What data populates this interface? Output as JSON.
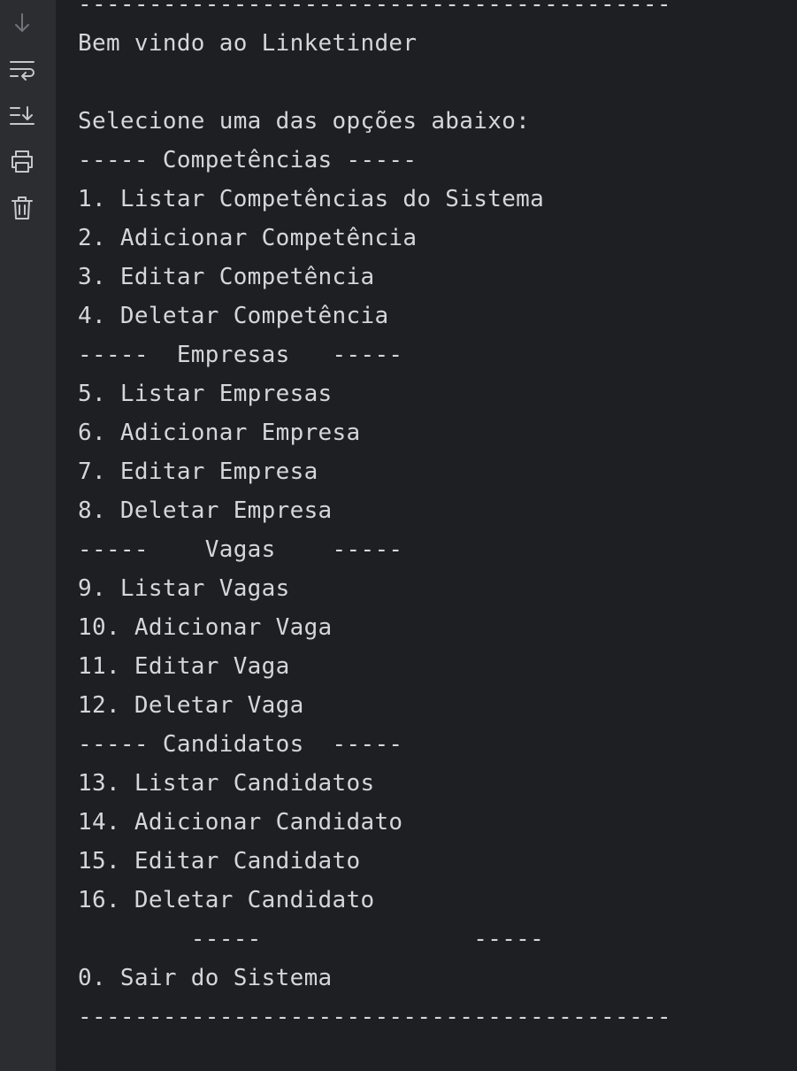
{
  "toolbar": {
    "icons": [
      "arrow-down-icon",
      "soft-wrap-icon",
      "scroll-to-end-icon",
      "print-icon",
      "trash-icon"
    ],
    "icon_color": "#8c9096"
  },
  "console": {
    "text_color": "#d4d6dc",
    "background": "#1e1f22",
    "lines": [
      "------------------------------------------",
      "Bem vindo ao Linketinder",
      "",
      "Selecione uma das opções abaixo:",
      "----- Competências -----",
      "1. Listar Competências do Sistema",
      "2. Adicionar Competência",
      "3. Editar Competência",
      "4. Deletar Competência",
      "-----  Empresas   -----",
      "5. Listar Empresas",
      "6. Adicionar Empresa",
      "7. Editar Empresa",
      "8. Deletar Empresa",
      "-----    Vagas    -----",
      "9. Listar Vagas",
      "10. Adicionar Vaga",
      "11. Editar Vaga",
      "12. Deletar Vaga",
      "----- Candidatos  -----",
      "13. Listar Candidatos",
      "14. Adicionar Candidato",
      "15. Editar Candidato",
      "16. Deletar Candidato",
      "        -----               -----",
      "0. Sair do Sistema",
      "------------------------------------------"
    ]
  }
}
